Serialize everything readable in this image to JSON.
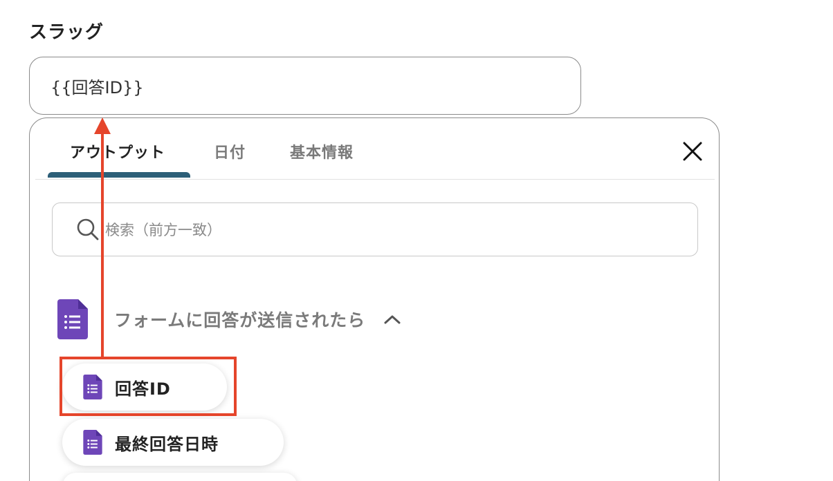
{
  "field": {
    "label": "スラッグ",
    "value": "{{回答ID}}"
  },
  "tabs": [
    {
      "label": "アウトプット",
      "active": true
    },
    {
      "label": "日付",
      "active": false
    },
    {
      "label": "基本情報",
      "active": false
    }
  ],
  "search": {
    "placeholder": "検索（前方一致）"
  },
  "section": {
    "title": "フォームに回答が送信されたら",
    "expanded": true
  },
  "items": [
    {
      "label": "回答ID",
      "highlighted": true
    },
    {
      "label": "最終回答日時",
      "highlighted": false
    }
  ],
  "colors": {
    "accent_tab": "#2d5f78",
    "forms_icon": "#6e46b8",
    "annotation": "#e5452b"
  },
  "icons": {
    "close": "close-icon",
    "search": "search-icon",
    "forms": "google-forms-icon",
    "chevron": "chevron-up-icon"
  }
}
